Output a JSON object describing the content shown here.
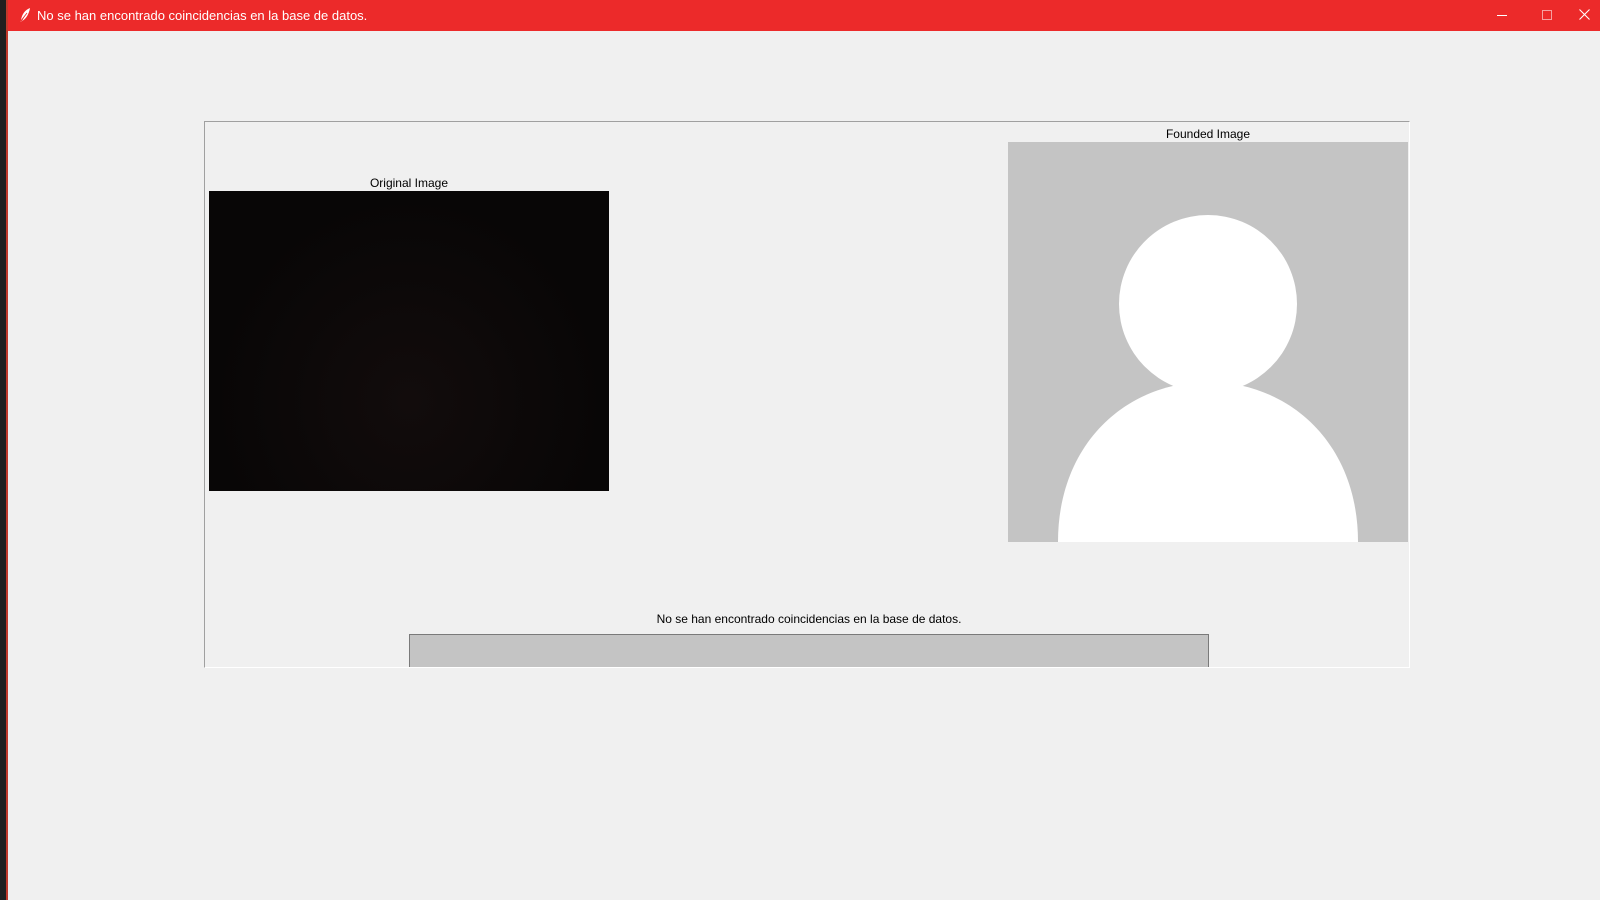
{
  "window": {
    "title": "No se han encontrado coincidencias en la base de datos.",
    "titlebar_color": "#ec2a2a",
    "icon": "feather-icon"
  },
  "controls": {
    "minimize_icon": "minimize-icon",
    "maximize_icon": "maximize-icon",
    "close_icon": "close-icon"
  },
  "original": {
    "label": "Original Image"
  },
  "found": {
    "label": "Founded Image",
    "placeholder_icon": "person-placeholder-icon"
  },
  "status": {
    "message": "No se han encontrado coincidencias en la base de datos."
  },
  "progress": {
    "value": 0
  }
}
